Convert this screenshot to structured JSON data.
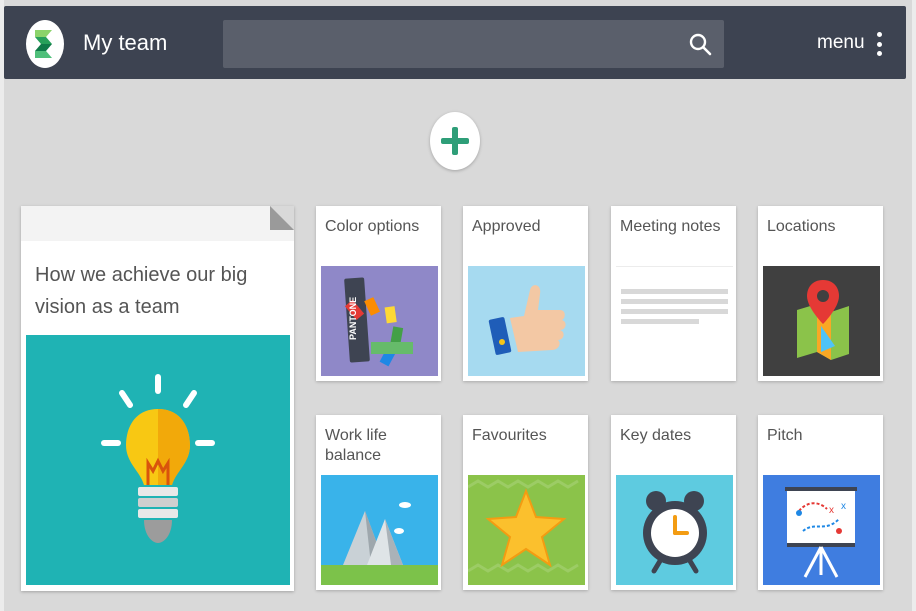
{
  "header": {
    "title": "My team",
    "search_placeholder": "",
    "menu_label": "menu"
  },
  "colors": {
    "topbar": "#3d4351",
    "background": "#d9d9d9",
    "add_accent": "#2e9e78"
  },
  "main_card": {
    "title": "How we achieve our big vision as a team",
    "image_icon": "lightbulb-icon"
  },
  "cards": [
    {
      "label": "Color options",
      "icon": "color-swatch-icon"
    },
    {
      "label": "Approved",
      "icon": "thumbs-up-icon"
    },
    {
      "label": "Meeting notes",
      "icon": "document-lines-icon"
    },
    {
      "label": "Locations",
      "icon": "map-pin-icon"
    },
    {
      "label": "Work life balance",
      "icon": "mountains-icon"
    },
    {
      "label": "Favourites",
      "icon": "star-icon"
    },
    {
      "label": "Key dates",
      "icon": "alarm-clock-icon"
    },
    {
      "label": "Pitch",
      "icon": "whiteboard-icon"
    }
  ],
  "swatch_text": "PANTONE"
}
